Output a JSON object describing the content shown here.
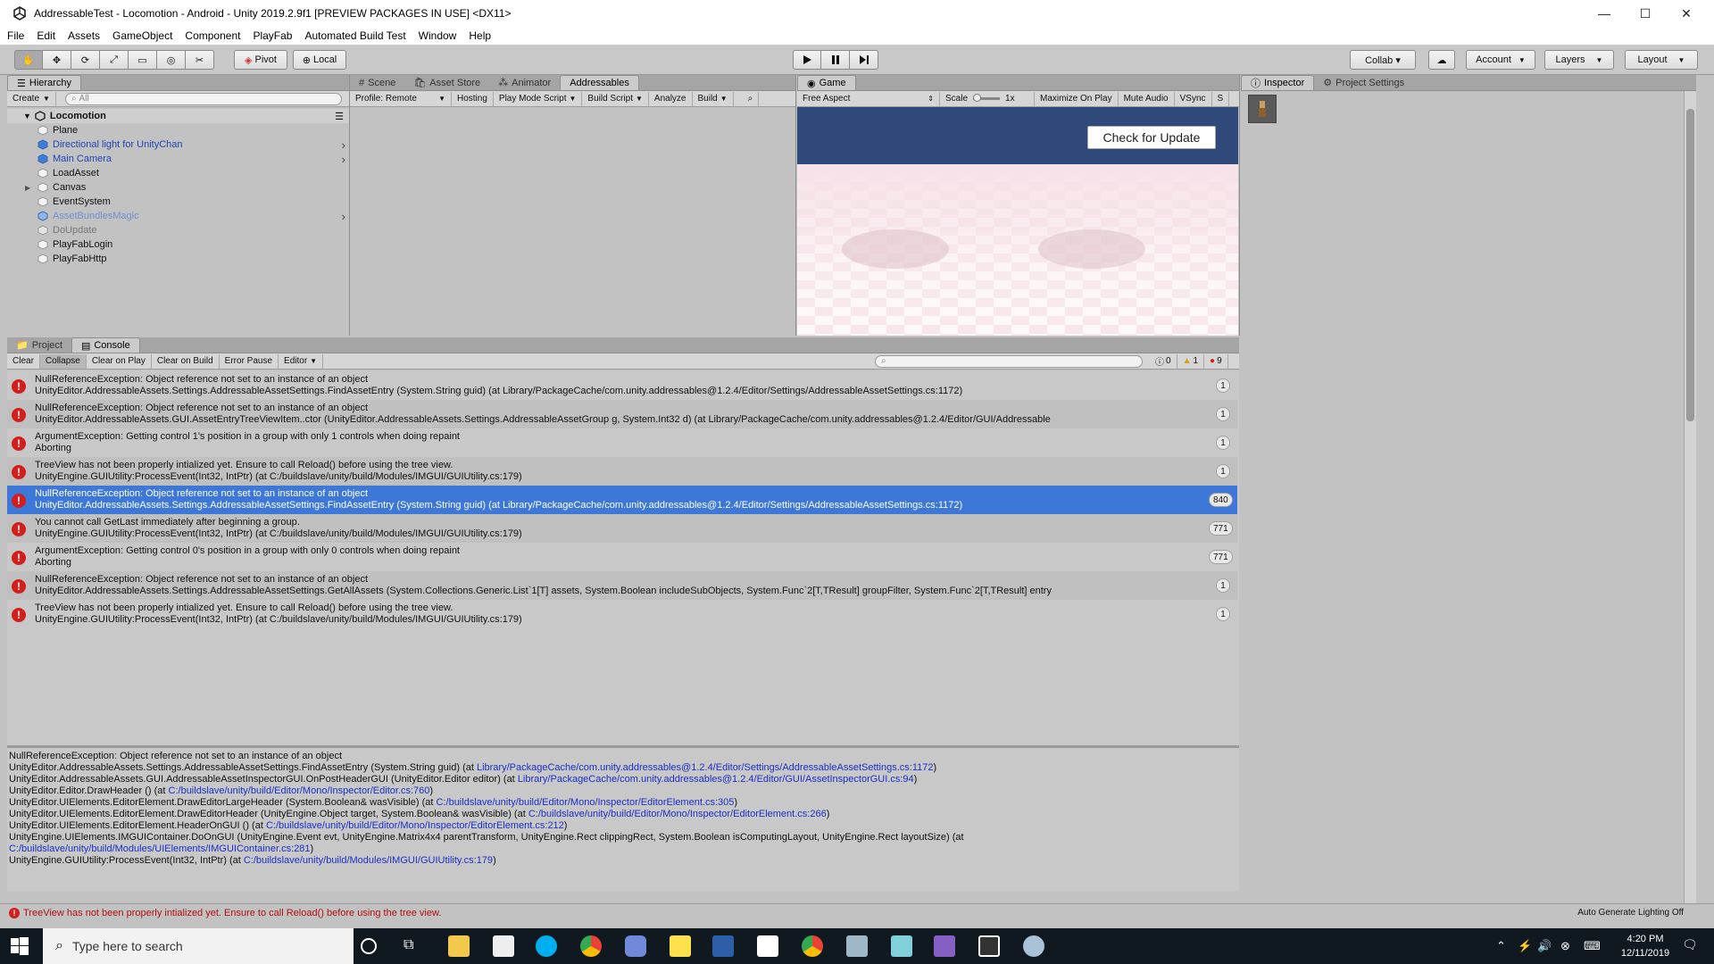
{
  "window": {
    "title": "AddressableTest - Locomotion - Android - Unity 2019.2.9f1 [PREVIEW PACKAGES IN USE] <DX11>",
    "minimize": "—",
    "maximize": "☐",
    "close": "✕"
  },
  "menu": [
    "File",
    "Edit",
    "Assets",
    "GameObject",
    "Component",
    "PlayFab",
    "Automated Build Test",
    "Window",
    "Help"
  ],
  "toolbar": {
    "pivot": "Pivot",
    "local": "Local",
    "collab": "Collab ▾",
    "account": "Account",
    "layers": "Layers",
    "layout": "Layout"
  },
  "hierarchy": {
    "tab": "Hierarchy",
    "create": "Create",
    "search_placeholder": "All",
    "scene": "Locomotion",
    "items": [
      {
        "name": "Plane",
        "style": "normal"
      },
      {
        "name": "Directional light for UnityChan",
        "style": "prefab"
      },
      {
        "name": "Main Camera",
        "style": "prefab"
      },
      {
        "name": "LoadAsset",
        "style": "normal"
      },
      {
        "name": "Canvas",
        "style": "normal"
      },
      {
        "name": "EventSystem",
        "style": "normal"
      },
      {
        "name": "AssetBundlesMagic",
        "style": "prefab-dim"
      },
      {
        "name": "DoUpdate",
        "style": "dim"
      },
      {
        "name": "PlayFabLogin",
        "style": "normal"
      },
      {
        "name": "PlayFabHttp",
        "style": "normal"
      }
    ]
  },
  "center_tabs": [
    "Scene",
    "Asset Store",
    "Animator",
    "Addressables"
  ],
  "addressables_bar": {
    "profile": "Profile: Remote",
    "hosting": "Hosting",
    "play_mode": "Play Mode Script",
    "build_script": "Build Script",
    "analyze": "Analyze",
    "build": "Build"
  },
  "game": {
    "tab": "Game",
    "aspect": "Free Aspect",
    "scale_label": "Scale",
    "scale_value": "1x",
    "maximize": "Maximize On Play",
    "mute": "Mute Audio",
    "vsync": "VSync",
    "stats": "S",
    "check_button": "Check for Update"
  },
  "inspector": {
    "tab": "Inspector",
    "settings_tab": "Project Settings"
  },
  "console": {
    "project_tab": "Project",
    "console_tab": "Console",
    "buttons": [
      "Clear",
      "Collapse",
      "Clear on Play",
      "Clear on Build",
      "Error Pause",
      "Editor"
    ],
    "info_count": "0",
    "warn_count": "1",
    "error_count": "9",
    "entries": [
      {
        "l1": "NullReferenceException: Object reference not set to an instance of an object",
        "l2": "UnityEditor.AddressableAssets.Settings.AddressableAssetSettings.FindAssetEntry (System.String guid) (at Library/PackageCache/com.unity.addressables@1.2.4/Editor/Settings/AddressableAssetSettings.cs:1172)",
        "count": "1",
        "selected": false
      },
      {
        "l1": "NullReferenceException: Object reference not set to an instance of an object",
        "l2": "UnityEditor.AddressableAssets.GUI.AssetEntryTreeViewItem..ctor (UnityEditor.AddressableAssets.Settings.AddressableAssetGroup g, System.Int32 d) (at Library/PackageCache/com.unity.addressables@1.2.4/Editor/GUI/Addressable",
        "count": "1",
        "selected": false
      },
      {
        "l1": "ArgumentException: Getting control 1's position in a group with only 1 controls when doing repaint",
        "l2": "Aborting",
        "count": "1",
        "selected": false
      },
      {
        "l1": "TreeView has not been properly intialized yet. Ensure to call Reload() before using the tree view.",
        "l2": "UnityEngine.GUIUtility:ProcessEvent(Int32, IntPtr) (at C:/buildslave/unity/build/Modules/IMGUI/GUIUtility.cs:179)",
        "count": "1",
        "selected": false
      },
      {
        "l1": "NullReferenceException: Object reference not set to an instance of an object",
        "l2": "UnityEditor.AddressableAssets.Settings.AddressableAssetSettings.FindAssetEntry (System.String guid) (at Library/PackageCache/com.unity.addressables@1.2.4/Editor/Settings/AddressableAssetSettings.cs:1172)",
        "count": "840",
        "selected": true
      },
      {
        "l1": "You cannot call GetLast immediately after beginning a group.",
        "l2": "UnityEngine.GUIUtility:ProcessEvent(Int32, IntPtr) (at C:/buildslave/unity/build/Modules/IMGUI/GUIUtility.cs:179)",
        "count": "771",
        "selected": false
      },
      {
        "l1": "ArgumentException: Getting control 0's position in a group with only 0 controls when doing repaint",
        "l2": "Aborting",
        "count": "771",
        "selected": false
      },
      {
        "l1": "NullReferenceException: Object reference not set to an instance of an object",
        "l2": "UnityEditor.AddressableAssets.Settings.AddressableAssetSettings.GetAllAssets (System.Collections.Generic.List`1[T] assets, System.Boolean includeSubObjects, System.Func`2[T,TResult] groupFilter, System.Func`2[T,TResult] entry",
        "count": "1",
        "selected": false
      },
      {
        "l1": "TreeView has not been properly intialized yet. Ensure to call Reload() before using the tree view.",
        "l2": "UnityEngine.GUIUtility:ProcessEvent(Int32, IntPtr) (at C:/buildslave/unity/build/Modules/IMGUI/GUIUtility.cs:179)",
        "count": "1",
        "selected": false
      }
    ],
    "stack": [
      {
        "text": "NullReferenceException: Object reference not set to an instance of an object",
        "link": "",
        "tail": ""
      },
      {
        "text": "UnityEditor.AddressableAssets.Settings.AddressableAssetSettings.FindAssetEntry (System.String guid) (at ",
        "link": "Library/PackageCache/com.unity.addressables@1.2.4/Editor/Settings/AddressableAssetSettings.cs:1172",
        "tail": ")"
      },
      {
        "text": "UnityEditor.AddressableAssets.GUI.AddressableAssetInspectorGUI.OnPostHeaderGUI (UnityEditor.Editor editor) (at ",
        "link": "Library/PackageCache/com.unity.addressables@1.2.4/Editor/GUI/AssetInspectorGUI.cs:94",
        "tail": ")"
      },
      {
        "text": "UnityEditor.Editor.DrawHeader () (at ",
        "link": "C:/buildslave/unity/build/Editor/Mono/Inspector/Editor.cs:760",
        "tail": ")"
      },
      {
        "text": "UnityEditor.UIElements.EditorElement.DrawEditorLargeHeader (System.Boolean& wasVisible) (at ",
        "link": "C:/buildslave/unity/build/Editor/Mono/Inspector/EditorElement.cs:305",
        "tail": ")"
      },
      {
        "text": "UnityEditor.UIElements.EditorElement.DrawEditorHeader (UnityEngine.Object target, System.Boolean& wasVisible) (at ",
        "link": "C:/buildslave/unity/build/Editor/Mono/Inspector/EditorElement.cs:266",
        "tail": ")"
      },
      {
        "text": "UnityEditor.UIElements.EditorElement.HeaderOnGUI () (at ",
        "link": "C:/buildslave/unity/build/Editor/Mono/Inspector/EditorElement.cs:212",
        "tail": ")"
      },
      {
        "text": "UnityEngine.UIElements.IMGUIContainer.DoOnGUI (UnityEngine.Event evt, UnityEngine.Matrix4x4 parentTransform, UnityEngine.Rect clippingRect, System.Boolean isComputingLayout, UnityEngine.Rect layoutSize) (at",
        "link": "",
        "tail": ""
      },
      {
        "text": "",
        "link": "C:/buildslave/unity/build/Modules/UIElements/IMGUIContainer.cs:281",
        "tail": ")"
      },
      {
        "text": "UnityEngine.GUIUtility:ProcessEvent(Int32, IntPtr) (at ",
        "link": "C:/buildslave/unity/build/Modules/IMGUI/GUIUtility.cs:179",
        "tail": ")"
      }
    ]
  },
  "status": {
    "message": "TreeView has not been properly intialized yet. Ensure to call Reload() before using the tree view.",
    "right": "Auto Generate Lighting Off"
  },
  "taskbar": {
    "search_placeholder": "Type here to search",
    "time": "4:20 PM",
    "date": "12/11/2019"
  },
  "colors": {
    "selection": "#3d78d8",
    "error": "#d41e1e",
    "link": "#1a2fc9",
    "game_sky": "#2f4a7a"
  }
}
